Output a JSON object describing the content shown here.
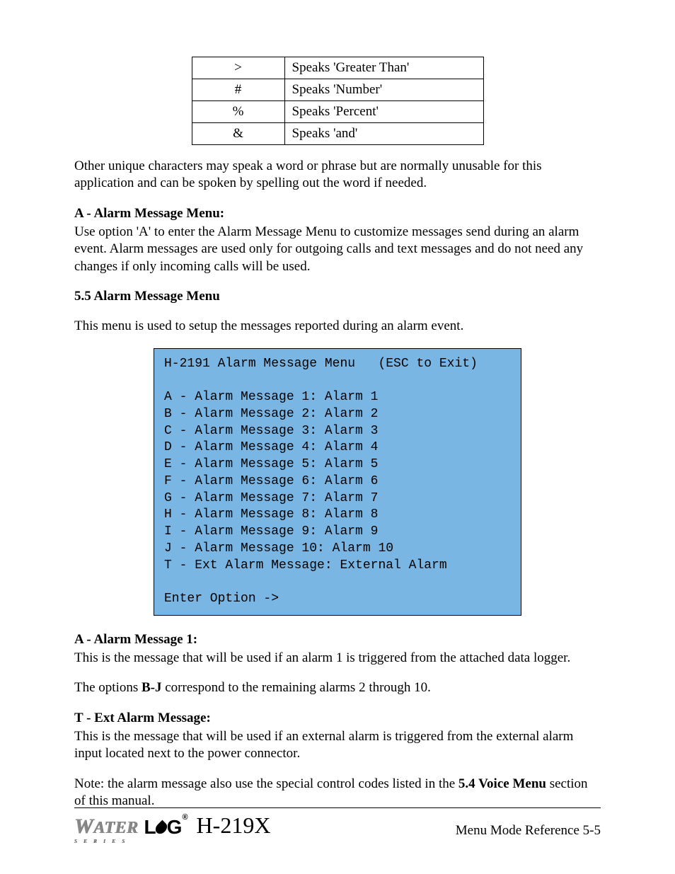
{
  "char_table": [
    {
      "sym": ">",
      "desc": "Speaks 'Greater Than'"
    },
    {
      "sym": "#",
      "desc": "Speaks 'Number'"
    },
    {
      "sym": "%",
      "desc": "Speaks 'Percent'"
    },
    {
      "sym": "&",
      "desc": "Speaks 'and'"
    }
  ],
  "p_other": "Other unique characters may speak a word or phrase but are normally unusable for this application and can be spoken by spelling out the word if needed.",
  "h_a": "A - Alarm Message Menu:",
  "p_a": "Use option 'A' to enter the Alarm Message Menu to customize messages send during an alarm event. Alarm messages are used only for outgoing calls and text messages and do not need any changes if only incoming calls will be used.",
  "h_55": "5.5 Alarm Message Menu",
  "p_55": "This menu is used to setup the messages reported during an alarm event.",
  "menu": "H-2191 Alarm Message Menu   (ESC to Exit)\n\nA - Alarm Message 1: Alarm 1\nB - Alarm Message 2: Alarm 2\nC - Alarm Message 3: Alarm 3\nD - Alarm Message 4: Alarm 4\nE - Alarm Message 5: Alarm 5\nF - Alarm Message 6: Alarm 6\nG - Alarm Message 7: Alarm 7\nH - Alarm Message 8: Alarm 8\nI - Alarm Message 9: Alarm 9\nJ - Alarm Message 10: Alarm 10\nT - Ext Alarm Message: External Alarm\n\nEnter Option ->",
  "h_a1": "A - Alarm Message 1:",
  "p_a1": "This is the message that will be used if an alarm 1 is triggered from the attached data logger.",
  "p_bj_pre": "The options ",
  "p_bj_bold": "B-J",
  "p_bj_post": " correspond to the remaining alarms 2 through 10.",
  "h_t": "T - Ext Alarm Message:",
  "p_t": "This is the message that will be used if an external alarm is triggered from the external alarm input located next to the power connector.",
  "p_note_pre": "Note: the alarm message also use the special control codes listed in the ",
  "p_note_bold": "5.4 Voice Menu",
  "p_note_post": " section of this manual.",
  "footer": {
    "water": "WATER",
    "lg_l": "L",
    "lg_g": "G",
    "reg": "®",
    "series": "S  E  R  I  E  S",
    "model": "H-219X",
    "right": "Menu Mode Reference  5-5"
  }
}
